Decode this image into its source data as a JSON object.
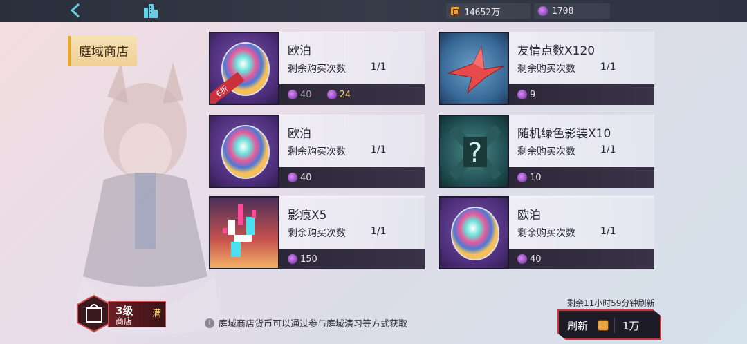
{
  "currencies": {
    "gold": "14652万",
    "crystal": "1708"
  },
  "shop_label": "庭域商店",
  "items": [
    {
      "name": "欧泊",
      "remain_label": "剩余购买次数",
      "remain": "1/1",
      "price_old": "40",
      "price": "24",
      "discount": "6折",
      "icon": "opal-gem-icon"
    },
    {
      "name": "友情点数X120",
      "remain_label": "剩余购买次数",
      "remain": "1/1",
      "price": "9",
      "icon": "paper-crane-icon"
    },
    {
      "name": "欧泊",
      "remain_label": "剩余购买次数",
      "remain": "1/1",
      "price": "40",
      "icon": "opal-gem-icon"
    },
    {
      "name": "随机绿色影装X10",
      "remain_label": "剩余购买次数",
      "remain": "1/1",
      "price": "10",
      "icon": "mystery-box-icon"
    },
    {
      "name": "影痕X5",
      "remain_label": "剩余购买次数",
      "remain": "1/1",
      "price": "150",
      "icon": "shadow-mark-icon"
    },
    {
      "name": "欧泊",
      "remain_label": "剩余购买次数",
      "remain": "1/1",
      "price": "40",
      "icon": "opal-gem-icon"
    }
  ],
  "level": {
    "level": "3级",
    "sub": "商店",
    "full": "满"
  },
  "tip": "庭域商店货币可以通过参与庭域演习等方式获取",
  "refresh": {
    "note": "剩余11小时59分钟刷新",
    "label": "刷新",
    "cost": "1万"
  }
}
